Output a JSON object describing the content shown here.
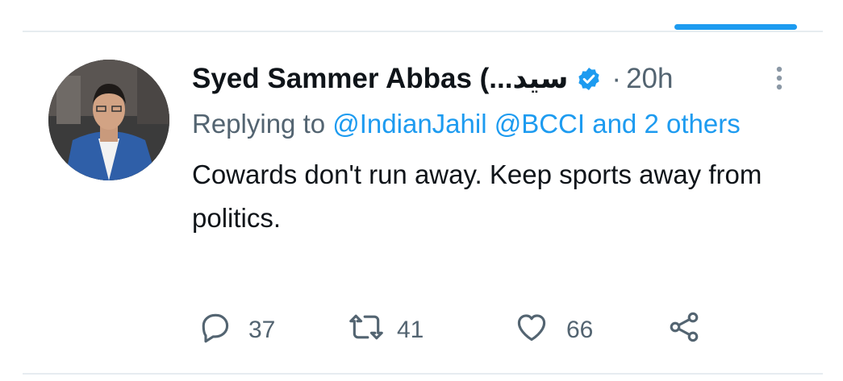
{
  "tweet": {
    "display_name": "Syed Sammer Abbas (...سید",
    "verified": true,
    "separator": "·",
    "time": "20h",
    "replying_prefix": "Replying to ",
    "replying_mentions": "@IndianJahil @BCCI and 2 others",
    "text": "Cowards don't run away. Keep sports away from politics.",
    "metrics": {
      "replies": "37",
      "retweets": "41",
      "likes": "66"
    }
  },
  "icons": {
    "verified": "verified-badge-icon",
    "more": "more-vertical-icon",
    "reply": "reply-icon",
    "retweet": "retweet-icon",
    "like": "heart-icon",
    "share": "share-icon"
  },
  "colors": {
    "accent": "#1d9bf0",
    "text": "#0f1419",
    "muted": "#536471",
    "divider": "#e6ecf0"
  }
}
